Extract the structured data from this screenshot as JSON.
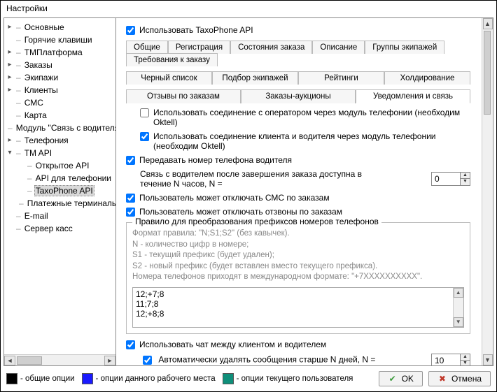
{
  "window": {
    "title": "Настройки"
  },
  "tree": {
    "items": [
      {
        "label": "Основные",
        "expandable": true,
        "level": 0
      },
      {
        "label": "Горячие клавиши",
        "level": 0
      },
      {
        "label": "ТМПлатформа",
        "expandable": true,
        "level": 0
      },
      {
        "label": "Заказы",
        "expandable": true,
        "level": 0
      },
      {
        "label": "Экипажи",
        "expandable": true,
        "level": 0
      },
      {
        "label": "Клиенты",
        "expandable": true,
        "level": 0
      },
      {
        "label": "СМС",
        "level": 0
      },
      {
        "label": "Карта",
        "level": 0
      },
      {
        "label": "Модуль \"Связь с водителями\"",
        "level": 0
      },
      {
        "label": "Телефония",
        "expandable": true,
        "level": 0
      },
      {
        "label": "TM API",
        "expanded": true,
        "expandable": true,
        "level": 0
      },
      {
        "label": "Открытое API",
        "level": 1
      },
      {
        "label": "API для телефонии",
        "level": 1
      },
      {
        "label": "TaxoPhone API",
        "level": 1,
        "selected": true
      },
      {
        "label": "Платежные терминалы",
        "level": 1
      },
      {
        "label": "E-mail",
        "level": 0
      },
      {
        "label": "Сервер касс",
        "level": 0
      }
    ]
  },
  "content": {
    "use_api_label": "Использовать TaxoPhone API",
    "use_api_checked": true,
    "tabs_row1": [
      {
        "label": "Общие"
      },
      {
        "label": "Регистрация"
      },
      {
        "label": "Состояния заказа"
      },
      {
        "label": "Описание"
      },
      {
        "label": "Группы экипажей"
      },
      {
        "label": "Требования к заказу"
      }
    ],
    "tabs_row2": [
      {
        "label": "Черный список"
      },
      {
        "label": "Подбор экипажей"
      },
      {
        "label": "Рейтинги"
      },
      {
        "label": "Холдирование"
      }
    ],
    "tabs_row3": [
      {
        "label": "Отзывы по заказам"
      },
      {
        "label": "Заказы-аукционы"
      },
      {
        "label": "Уведомления и связь",
        "active": true
      }
    ],
    "oktell_operator": {
      "label": "Использовать соединение с оператором через модуль телефонии (необходим Oktell)",
      "checked": false
    },
    "oktell_client_driver": {
      "label": "Использовать соединение клиента и водителя через модуль телефонии (необходим Oktell)",
      "checked": true
    },
    "forward_driver_phone": {
      "label": "Передавать номер телефона водителя",
      "checked": true
    },
    "contact_after": {
      "label": "Связь с водителем после завершения заказа доступна в течение N часов, N =",
      "value": "0"
    },
    "user_disable_sms": {
      "label": "Пользователь может отключать СМС по заказам",
      "checked": true
    },
    "user_disable_callback": {
      "label": "Пользователь может отключать отзвоны по заказам",
      "checked": true
    },
    "prefix_group": {
      "legend": "Правило для преобразования префиксов номеров телефонов",
      "hint_lines": [
        "Формат правила: \"N;S1;S2\" (без кавычек).",
        "N - количество цифр в номере;",
        "S1 - текущий префикс (будет удален);",
        "S2 - новый префикс (будет вставлен вместо текущего префикса).",
        "Номера телефонов приходят в международном формате: \"+7XXXXXXXXXX\"."
      ],
      "rules_text": "12;+7;8\n11;7;8\n12;+8;8"
    },
    "use_chat": {
      "label": "Использовать чат между клиентом и водителем",
      "checked": true
    },
    "auto_delete": {
      "label": "Автоматически удалять сообщения старше N дней, N =",
      "checked": true,
      "value": "10"
    }
  },
  "footer": {
    "legend": [
      {
        "label": "- общие опции",
        "color": "#000000"
      },
      {
        "label": "- опции данного рабочего места",
        "color": "#1a1aff"
      },
      {
        "label": "- опции текущего пользователя",
        "color": "#0f8f7a"
      }
    ],
    "ok_label": "OK",
    "cancel_label": "Отмена"
  }
}
